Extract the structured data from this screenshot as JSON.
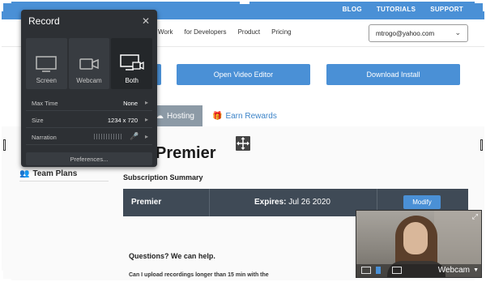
{
  "topbar": {
    "links": [
      "BLOG",
      "TUTORIALS",
      "SUPPORT"
    ]
  },
  "nav": {
    "items": [
      "Work",
      "for Developers",
      "Product",
      "Pricing"
    ],
    "account_email": "mtrogo@yahoo.com"
  },
  "actions": {
    "open_editor": "Open Video Editor",
    "download_install": "Download Install"
  },
  "tabs": {
    "hosting": "Hosting",
    "earn_rewards": "Earn Rewards"
  },
  "page": {
    "title": "Premier",
    "team_plans": "Team Plans",
    "subscription_summary": "Subscription Summary",
    "plan_name": "Premier",
    "expires_label": "Expires:",
    "expires_date": "Jul 26 2020",
    "modify_button": "Modify",
    "questions_heading": "Questions? We can help.",
    "faq_question": "Can I upload recordings longer than 15 min with the"
  },
  "recorder": {
    "title": "Record",
    "modes": [
      {
        "label": "Screen",
        "icon": "screen-icon",
        "active": false
      },
      {
        "label": "Webcam",
        "icon": "webcam-icon",
        "active": false
      },
      {
        "label": "Both",
        "icon": "screen-webcam-icon",
        "active": true
      }
    ],
    "settings": [
      {
        "key": "Max Time",
        "value": "None"
      },
      {
        "key": "Size",
        "value": "1234 x 720"
      },
      {
        "key": "Narration",
        "value": ""
      }
    ],
    "preferences_button": "Preferences..."
  },
  "webcam_overlay": {
    "source_label": "Webcam"
  },
  "colors": {
    "accent": "#4a90d6",
    "panel_bg": "#2d3034",
    "plan_bar": "#3f4a56",
    "tab_active": "#8c9aa6"
  }
}
